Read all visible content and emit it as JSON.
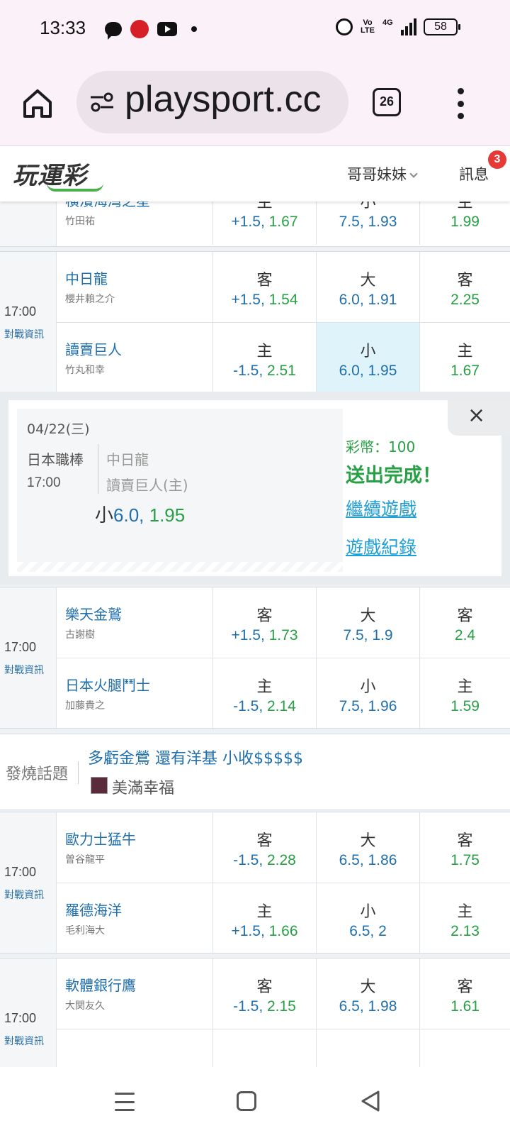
{
  "status_bar": {
    "time": "13:33",
    "battery": "58",
    "network": "4G",
    "volte": "Vo LTE",
    "icons_left": [
      "chat-icon",
      "app-icon",
      "youtube-icon",
      "dot-icon"
    ],
    "icons_right": [
      "alarm-icon",
      "volte-icon",
      "signal-icon",
      "battery-icon"
    ]
  },
  "browser": {
    "url": "playsport.cc",
    "tab_count": "26"
  },
  "site": {
    "logo": "玩運彩",
    "user_name": "哥哥妹妹",
    "messages_label": "訊息",
    "messages_badge": "3"
  },
  "games": [
    {
      "time": "",
      "info": "",
      "rows": [
        {
          "team": "橫濱海灣之星",
          "pitcher": "竹田祐",
          "c1_key": "主",
          "c1_line": "+1.5",
          "c1_odds": "1.67",
          "c2_key": "小",
          "c2_line": "7.5",
          "c2_odds": "1.93",
          "c3_key": "主",
          "c3_odds": "1.99"
        }
      ]
    },
    {
      "time": "17:00",
      "info": "對戰資訊",
      "rows": [
        {
          "team": "中日龍",
          "pitcher": "櫻井賴之介",
          "c1_key": "客",
          "c1_line": "+1.5",
          "c1_odds": "1.54",
          "c2_key": "大",
          "c2_line": "6.0",
          "c2_odds": "1.91",
          "c3_key": "客",
          "c3_odds": "2.25"
        },
        {
          "team": "讀賣巨人",
          "pitcher": "竹丸和幸",
          "c1_key": "主",
          "c1_line": "-1.5",
          "c1_odds": "2.51",
          "c2_key": "小",
          "c2_line": "6.0",
          "c2_odds": "1.95",
          "c3_key": "主",
          "c3_odds": "1.67"
        }
      ]
    },
    {
      "time": "17:00",
      "info": "對戰資訊",
      "rows": [
        {
          "team": "樂天金鷲",
          "pitcher": "古謝樹",
          "c1_key": "客",
          "c1_line": "+1.5",
          "c1_odds": "1.73",
          "c2_key": "大",
          "c2_line": "7.5",
          "c2_odds": "1.9",
          "c3_key": "客",
          "c3_odds": "2.4"
        },
        {
          "team": "日本火腿鬥士",
          "pitcher": "加藤貴之",
          "c1_key": "主",
          "c1_line": "-1.5",
          "c1_odds": "2.14",
          "c2_key": "小",
          "c2_line": "7.5",
          "c2_odds": "1.96",
          "c3_key": "主",
          "c3_odds": "1.59"
        }
      ]
    },
    {
      "time": "17:00",
      "info": "對戰資訊",
      "rows": [
        {
          "team": "歐力士猛牛",
          "pitcher": "曽谷龍平",
          "c1_key": "客",
          "c1_line": "-1.5",
          "c1_odds": "2.28",
          "c2_key": "大",
          "c2_line": "6.5",
          "c2_odds": "1.86",
          "c3_key": "客",
          "c3_odds": "1.75"
        },
        {
          "team": "羅德海洋",
          "pitcher": "毛利海大",
          "c1_key": "主",
          "c1_line": "+1.5",
          "c1_odds": "1.66",
          "c2_key": "小",
          "c2_line": "6.5",
          "c2_odds": "2",
          "c3_key": "主",
          "c3_odds": "2.13"
        }
      ]
    },
    {
      "time": "17:00",
      "info": "對戰資訊",
      "rows": [
        {
          "team": "軟體銀行鷹",
          "pitcher": "大関友久",
          "c1_key": "客",
          "c1_line": "-1.5",
          "c1_odds": "2.15",
          "c2_key": "大",
          "c2_line": "6.5",
          "c2_odds": "1.98",
          "c3_key": "客",
          "c3_odds": "1.61"
        }
      ]
    }
  ],
  "bet_popup": {
    "date": "04/22(三)",
    "league": "日本職棒",
    "time": "17:00",
    "away_team": "中日龍",
    "home_team": "讀賣巨人(主)",
    "pick_key": "小",
    "pick_line": "6.0,",
    "pick_odds": " 1.95",
    "coins_text": "彩幣：100",
    "done_text": "送出完成！",
    "continue_link": "繼續遊戲",
    "history_link": "遊戲紀錄",
    "close_label": "×"
  },
  "hot_topic": {
    "label": "發燒話題",
    "title": "多虧金鶯 還有洋基 小收$$$$$",
    "author": "美滿幸福"
  }
}
